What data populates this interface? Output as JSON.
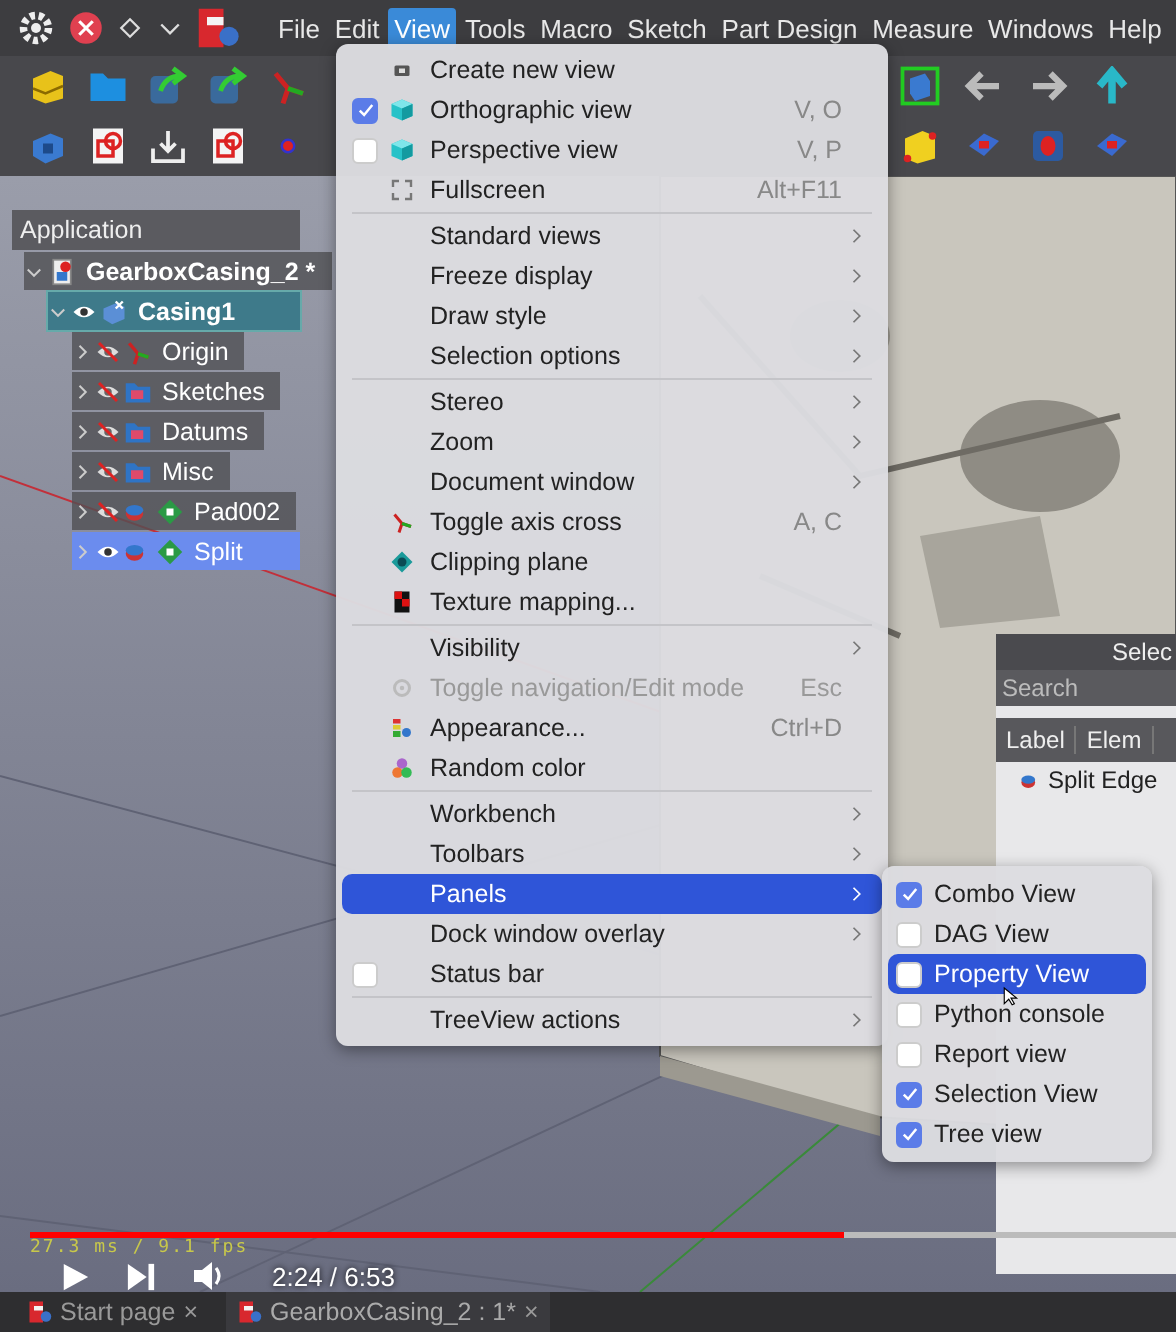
{
  "menubar": {
    "items": [
      {
        "label": "File",
        "selected": false
      },
      {
        "label": "Edit",
        "selected": false
      },
      {
        "label": "View",
        "selected": true
      },
      {
        "label": "Tools",
        "selected": false
      },
      {
        "label": "Macro",
        "selected": false
      },
      {
        "label": "Sketch",
        "selected": false
      },
      {
        "label": "Part Design",
        "selected": false
      },
      {
        "label": "Measure",
        "selected": false
      },
      {
        "label": "Windows",
        "selected": false
      },
      {
        "label": "Help",
        "selected": false
      }
    ]
  },
  "tree": {
    "header": "Application",
    "items": [
      {
        "kind": "document",
        "label": "GearboxCasing_2 *",
        "expanded": true,
        "selected": false,
        "active": false,
        "children": [
          {
            "kind": "body",
            "label": "Casing1",
            "expanded": true,
            "visible": true,
            "selected": false,
            "active": true,
            "children": [
              {
                "kind": "origin",
                "label": "Origin",
                "expanded": false,
                "visible": false,
                "selected": false,
                "active": false
              },
              {
                "kind": "group",
                "label": "Sketches",
                "expanded": false,
                "visible": false,
                "selected": false,
                "active": false
              },
              {
                "kind": "group",
                "label": "Datums",
                "expanded": false,
                "visible": false,
                "selected": false,
                "active": false
              },
              {
                "kind": "group",
                "label": "Misc",
                "expanded": false,
                "visible": false,
                "selected": false,
                "active": false
              },
              {
                "kind": "feature",
                "label": "Pad002",
                "expanded": false,
                "visible": false,
                "selected": false,
                "active": false
              },
              {
                "kind": "feature",
                "label": "Split",
                "expanded": false,
                "visible": true,
                "selected": true,
                "active": false
              }
            ]
          }
        ]
      }
    ]
  },
  "view_menu": {
    "items": [
      {
        "kind": "action",
        "label": "Create new view",
        "selected": false,
        "disabled": false
      },
      {
        "kind": "check",
        "label": "Orthographic view",
        "shortcut": "V, O",
        "checked": true,
        "selected": false,
        "disabled": false
      },
      {
        "kind": "check",
        "label": "Perspective view",
        "shortcut": "V, P",
        "checked": false,
        "selected": false,
        "disabled": false
      },
      {
        "kind": "action",
        "label": "Fullscreen",
        "shortcut": "Alt+F11",
        "selected": false,
        "disabled": false
      },
      {
        "kind": "separator"
      },
      {
        "kind": "submenu",
        "label": "Standard views",
        "selected": false,
        "disabled": false
      },
      {
        "kind": "submenu",
        "label": "Freeze display",
        "selected": false,
        "disabled": false
      },
      {
        "kind": "submenu",
        "label": "Draw style",
        "selected": false,
        "disabled": false
      },
      {
        "kind": "submenu",
        "label": "Selection options",
        "selected": false,
        "disabled": false
      },
      {
        "kind": "separator"
      },
      {
        "kind": "submenu",
        "label": "Stereo",
        "selected": false,
        "disabled": false
      },
      {
        "kind": "submenu",
        "label": "Zoom",
        "selected": false,
        "disabled": false
      },
      {
        "kind": "submenu",
        "label": "Document window",
        "selected": false,
        "disabled": false
      },
      {
        "kind": "action",
        "label": "Toggle axis cross",
        "shortcut": "A, C",
        "selected": false,
        "disabled": false
      },
      {
        "kind": "action",
        "label": "Clipping plane",
        "selected": false,
        "disabled": false
      },
      {
        "kind": "action",
        "label": "Texture mapping...",
        "selected": false,
        "disabled": false
      },
      {
        "kind": "separator"
      },
      {
        "kind": "submenu",
        "label": "Visibility",
        "selected": false,
        "disabled": false
      },
      {
        "kind": "action",
        "label": "Toggle navigation/Edit mode",
        "shortcut": "Esc",
        "selected": false,
        "disabled": true
      },
      {
        "kind": "action",
        "label": "Appearance...",
        "shortcut": "Ctrl+D",
        "selected": false,
        "disabled": false
      },
      {
        "kind": "action",
        "label": "Random color",
        "selected": false,
        "disabled": false
      },
      {
        "kind": "separator"
      },
      {
        "kind": "submenu",
        "label": "Workbench",
        "selected": false,
        "disabled": false
      },
      {
        "kind": "submenu",
        "label": "Toolbars",
        "selected": false,
        "disabled": false
      },
      {
        "kind": "submenu",
        "label": "Panels",
        "selected": true,
        "disabled": false
      },
      {
        "kind": "submenu",
        "label": "Dock window overlay",
        "selected": false,
        "disabled": false
      },
      {
        "kind": "check",
        "label": "Status bar",
        "checked": false,
        "selected": false,
        "disabled": false
      },
      {
        "kind": "separator"
      },
      {
        "kind": "submenu",
        "label": "TreeView actions",
        "selected": false,
        "disabled": false
      }
    ]
  },
  "panels_menu": {
    "items": [
      {
        "label": "Combo View",
        "checked": true,
        "selected": false
      },
      {
        "label": "DAG View",
        "checked": false,
        "selected": false
      },
      {
        "label": "Property View",
        "checked": false,
        "selected": true
      },
      {
        "label": "Python console",
        "checked": false,
        "selected": false
      },
      {
        "label": "Report view",
        "checked": false,
        "selected": false
      },
      {
        "label": "Selection View",
        "checked": true,
        "selected": false
      },
      {
        "label": "Tree view",
        "checked": true,
        "selected": false
      }
    ]
  },
  "selection_panel": {
    "title": "Selec",
    "search": {
      "placeholder": "Search"
    },
    "columns": [
      "Label",
      "Elem"
    ],
    "rows": [
      {
        "label": "Split Edge"
      }
    ]
  },
  "viewport": {
    "overlay_text": "27.3 ms / 9.1 fps"
  },
  "player": {
    "progress": {
      "level": 0.71
    },
    "time": "2:24 / 6:53"
  },
  "document_tabs": [
    {
      "label": "Start page",
      "close": "×",
      "selected": false
    },
    {
      "label": "GearboxCasing_2 : 1*",
      "close": "×",
      "selected": true
    }
  ]
}
